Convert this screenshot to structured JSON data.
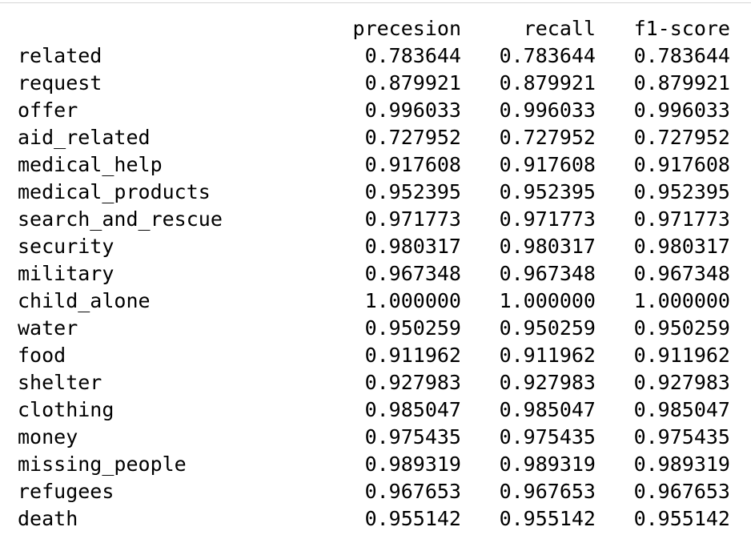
{
  "table": {
    "columns": [
      "precesion",
      "recall",
      "f1-score"
    ],
    "rows": [
      {
        "label": "related",
        "values": [
          "0.783644",
          "0.783644",
          "0.783644"
        ]
      },
      {
        "label": "request",
        "values": [
          "0.879921",
          "0.879921",
          "0.879921"
        ]
      },
      {
        "label": "offer",
        "values": [
          "0.996033",
          "0.996033",
          "0.996033"
        ]
      },
      {
        "label": "aid_related",
        "values": [
          "0.727952",
          "0.727952",
          "0.727952"
        ]
      },
      {
        "label": "medical_help",
        "values": [
          "0.917608",
          "0.917608",
          "0.917608"
        ]
      },
      {
        "label": "medical_products",
        "values": [
          "0.952395",
          "0.952395",
          "0.952395"
        ]
      },
      {
        "label": "search_and_rescue",
        "values": [
          "0.971773",
          "0.971773",
          "0.971773"
        ]
      },
      {
        "label": "security",
        "values": [
          "0.980317",
          "0.980317",
          "0.980317"
        ]
      },
      {
        "label": "military",
        "values": [
          "0.967348",
          "0.967348",
          "0.967348"
        ]
      },
      {
        "label": "child_alone",
        "values": [
          "1.000000",
          "1.000000",
          "1.000000"
        ]
      },
      {
        "label": "water",
        "values": [
          "0.950259",
          "0.950259",
          "0.950259"
        ]
      },
      {
        "label": "food",
        "values": [
          "0.911962",
          "0.911962",
          "0.911962"
        ]
      },
      {
        "label": "shelter",
        "values": [
          "0.927983",
          "0.927983",
          "0.927983"
        ]
      },
      {
        "label": "clothing",
        "values": [
          "0.985047",
          "0.985047",
          "0.985047"
        ]
      },
      {
        "label": "money",
        "values": [
          "0.975435",
          "0.975435",
          "0.975435"
        ]
      },
      {
        "label": "missing_people",
        "values": [
          "0.989319",
          "0.989319",
          "0.989319"
        ]
      },
      {
        "label": "refugees",
        "values": [
          "0.967653",
          "0.967653",
          "0.967653"
        ]
      },
      {
        "label": "death",
        "values": [
          "0.955142",
          "0.955142",
          "0.955142"
        ]
      }
    ]
  }
}
